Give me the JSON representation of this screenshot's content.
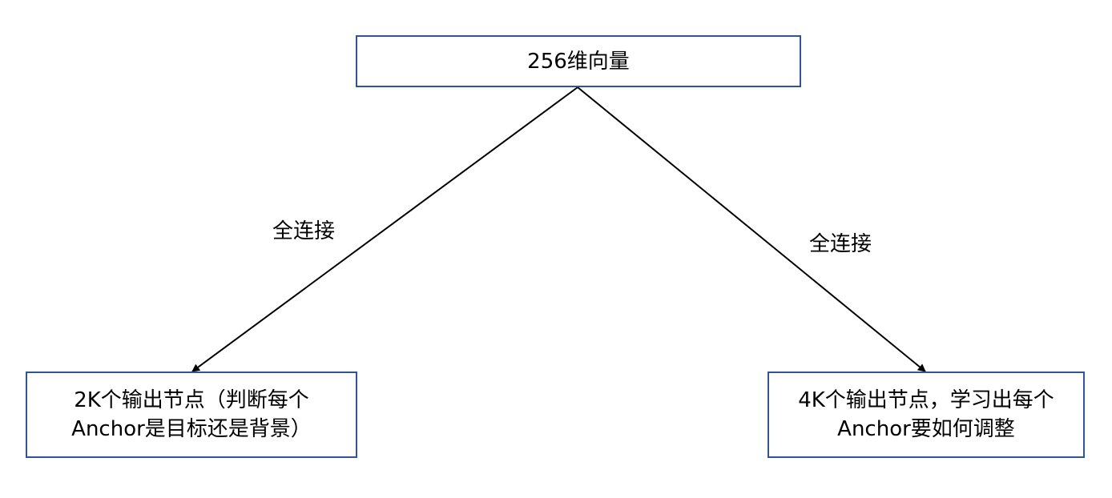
{
  "nodes": {
    "top": "256维向量",
    "left_line1": "2K个输出节点（判断每个",
    "left_line2": "Anchor是目标还是背景）",
    "right_line1": "4K个输出节点，学习出每个",
    "right_line2": "Anchor要如何调整"
  },
  "edges": {
    "left_label": "全连接",
    "right_label": "全连接"
  },
  "colors": {
    "border": "#2f5597",
    "line": "#000000"
  }
}
